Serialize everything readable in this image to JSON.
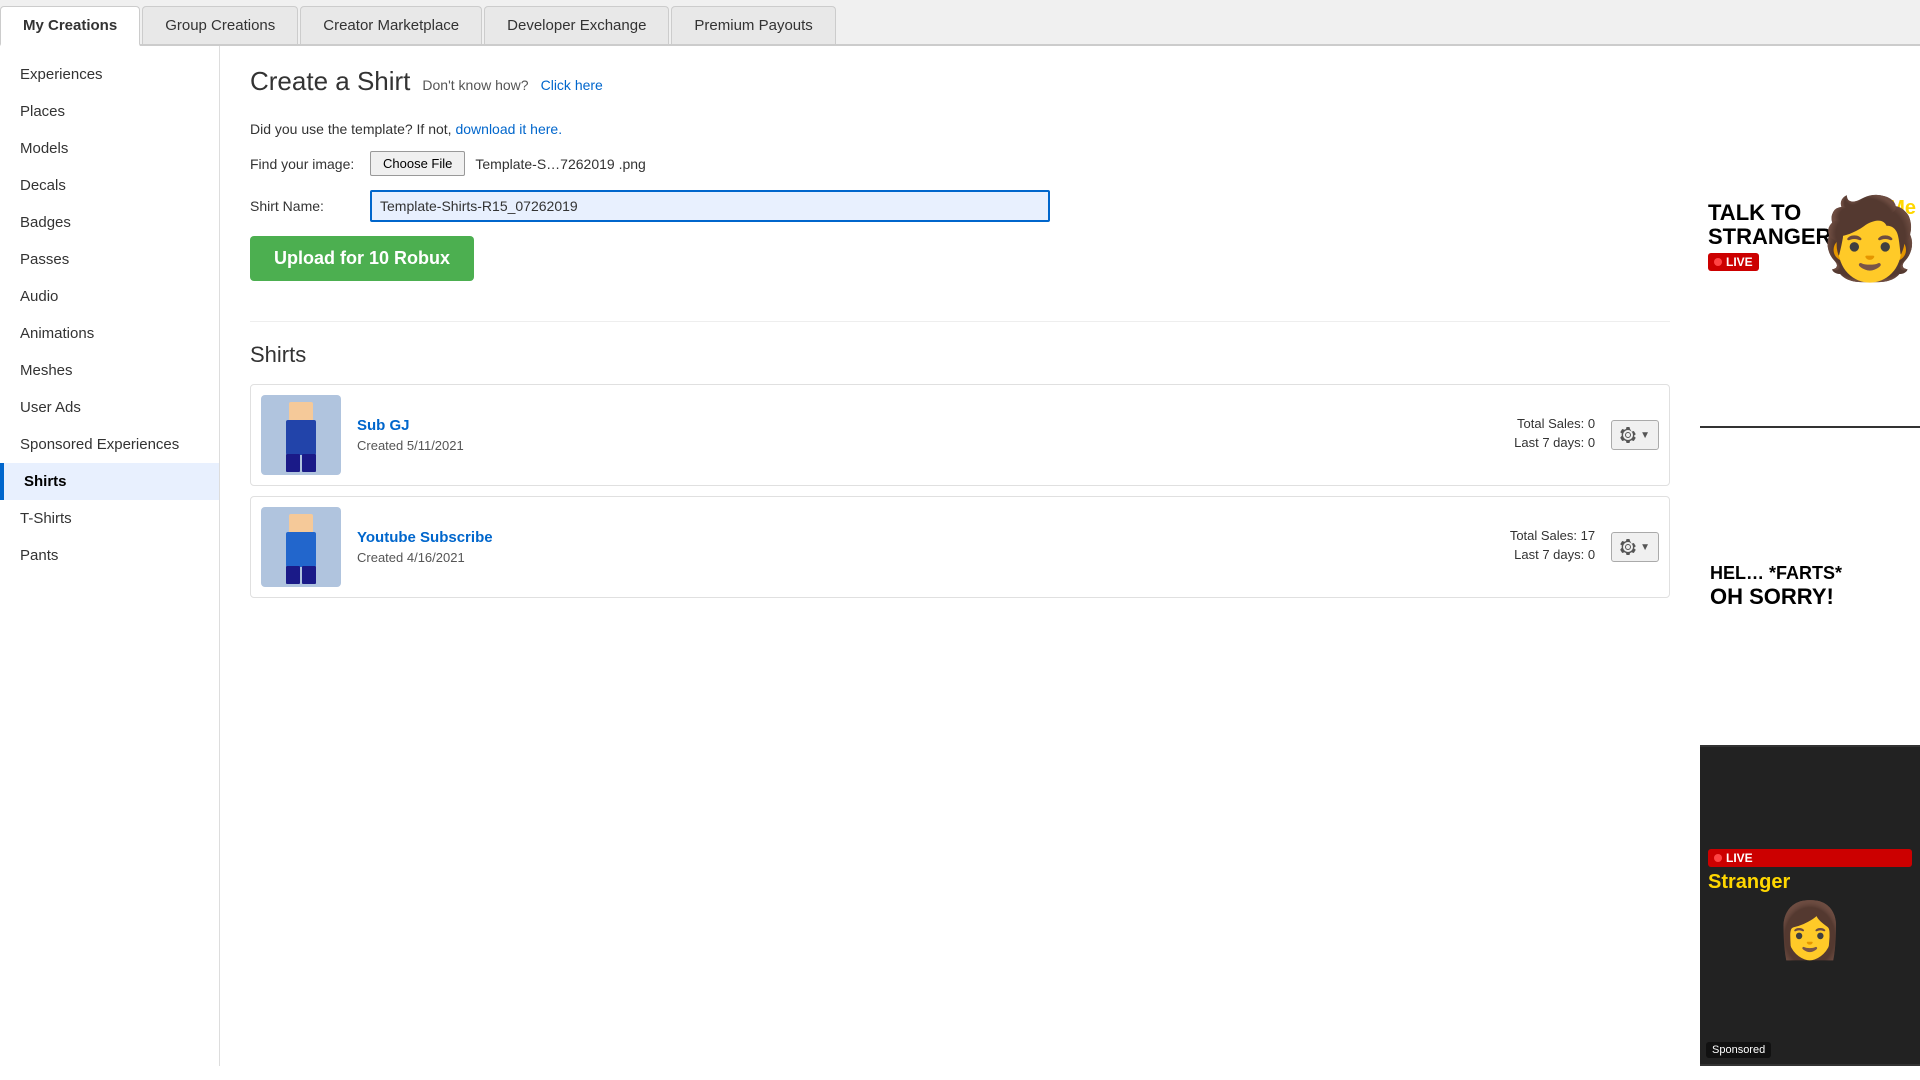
{
  "topNav": {
    "tabs": [
      {
        "id": "my-creations",
        "label": "My Creations",
        "active": true
      },
      {
        "id": "group-creations",
        "label": "Group Creations",
        "active": false
      },
      {
        "id": "creator-marketplace",
        "label": "Creator Marketplace",
        "active": false
      },
      {
        "id": "developer-exchange",
        "label": "Developer Exchange",
        "active": false
      },
      {
        "id": "premium-payouts",
        "label": "Premium Payouts",
        "active": false
      }
    ]
  },
  "sidebar": {
    "items": [
      {
        "id": "experiences",
        "label": "Experiences",
        "active": false
      },
      {
        "id": "places",
        "label": "Places",
        "active": false
      },
      {
        "id": "models",
        "label": "Models",
        "active": false
      },
      {
        "id": "decals",
        "label": "Decals",
        "active": false
      },
      {
        "id": "badges",
        "label": "Badges",
        "active": false
      },
      {
        "id": "passes",
        "label": "Passes",
        "active": false
      },
      {
        "id": "audio",
        "label": "Audio",
        "active": false
      },
      {
        "id": "animations",
        "label": "Animations",
        "active": false
      },
      {
        "id": "meshes",
        "label": "Meshes",
        "active": false
      },
      {
        "id": "user-ads",
        "label": "User Ads",
        "active": false
      },
      {
        "id": "sponsored-experiences",
        "label": "Sponsored Experiences",
        "active": false
      },
      {
        "id": "shirts",
        "label": "Shirts",
        "active": true
      },
      {
        "id": "t-shirts",
        "label": "T-Shirts",
        "active": false
      },
      {
        "id": "pants",
        "label": "Pants",
        "active": false
      }
    ]
  },
  "createShirt": {
    "title": "Create a Shirt",
    "dontKnow": "Don't know how?",
    "clickHere": "Click here",
    "templateNote": "Did you use the template? If not,",
    "downloadLink": "download it here.",
    "findImageLabel": "Find your image:",
    "chooseFileBtn": "Choose File",
    "fileName": "Template-S…7262019 .png",
    "shirtNameLabel": "Shirt Name:",
    "shirtNameValue": "Template-Shirts-R15_07262019",
    "uploadBtn": "Upload for 10 Robux"
  },
  "shirts": {
    "sectionTitle": "Shirts",
    "items": [
      {
        "id": "sub-gj",
        "name": "Sub GJ",
        "created": "Created  5/11/2021",
        "totalSales": "Total Sales: 0",
        "last7Days": "Last 7 days: 0"
      },
      {
        "id": "youtube-subscribe",
        "name": "Youtube Subscribe",
        "created": "Created  4/16/2021",
        "totalSales": "Total Sales: 17",
        "last7Days": "Last 7 days: 0"
      }
    ]
  },
  "ads": {
    "ad1": {
      "title": "TALK TO\nSTRANGERS",
      "liveBadge": "LIVE",
      "meLabel": "Me"
    },
    "ad2": {
      "line1": "HEL… *FARTS*",
      "line2": "OH SORRY!"
    },
    "ad3": {
      "liveBadge": "LIVE",
      "strangerLabel": "Stranger"
    },
    "sponsoredLabel": "Sponsored"
  }
}
